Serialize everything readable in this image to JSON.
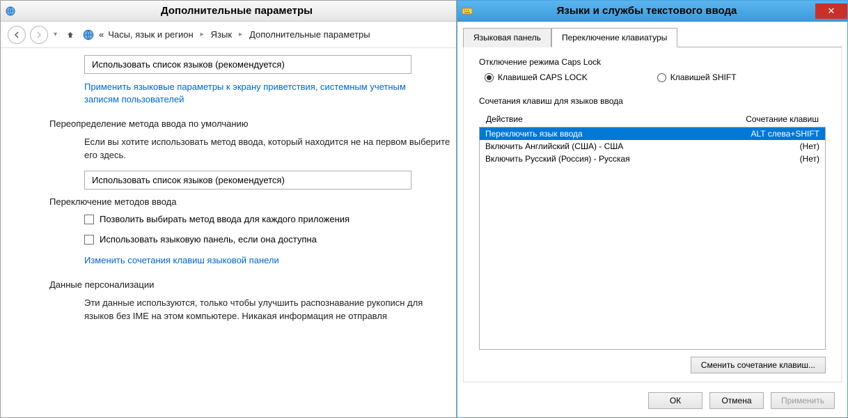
{
  "cp": {
    "title": "Дополнительные параметры",
    "breadcrumbs": {
      "root_glyph": "«",
      "items": [
        "Часы, язык и регион",
        "Язык",
        "Дополнительные параметры"
      ]
    },
    "dropdown1": "Использовать список языков (рекомендуется)",
    "link_welcome": "Применить языковые параметры к экрану приветствия, системным учетным записям пользователей",
    "section_override": "Переопределение метода ввода по умолчанию",
    "override_text": "Если вы хотите использовать метод ввода, который находится не на первом выберите его здесь.",
    "dropdown2": "Использовать список языков (рекомендуется)",
    "section_switch": "Переключение методов ввода",
    "check1": "Позволить выбирать метод ввода для каждого приложения",
    "check2": "Использовать языковую панель, если она доступна",
    "link_hotkeys": "Изменить сочетания клавиш языковой панели",
    "section_personal": "Данные персонализации",
    "personal_text": "Эти данные используются, только чтобы улучшить распознавание рукописн для языков без IME на этом компьютере. Никакая информация не отправля"
  },
  "dlg": {
    "title": "Языки и службы текстового ввода",
    "tabs": {
      "lang_panel": "Языковая панель",
      "kb_switch": "Переключение клавиатуры"
    },
    "caps_group": "Отключение режима Caps Lock",
    "radio_caps": "Клавишей CAPS LOCK",
    "radio_shift": "Клавишей SHIFT",
    "hotkey_group": "Сочетания клавиш для языков ввода",
    "col_action": "Действие",
    "col_hotkey": "Сочетание клавиш",
    "rows": [
      {
        "action": "Переключить язык ввода",
        "hotkey": "ALT слева+SHIFT"
      },
      {
        "action": "Включить Английский (США) - США",
        "hotkey": "(Нет)"
      },
      {
        "action": "Включить Русский (Россия) - Русская",
        "hotkey": "(Нет)"
      }
    ],
    "change_btn": "Сменить сочетание клавиш...",
    "ok": "ОК",
    "cancel": "Отмена",
    "apply": "Применить"
  }
}
